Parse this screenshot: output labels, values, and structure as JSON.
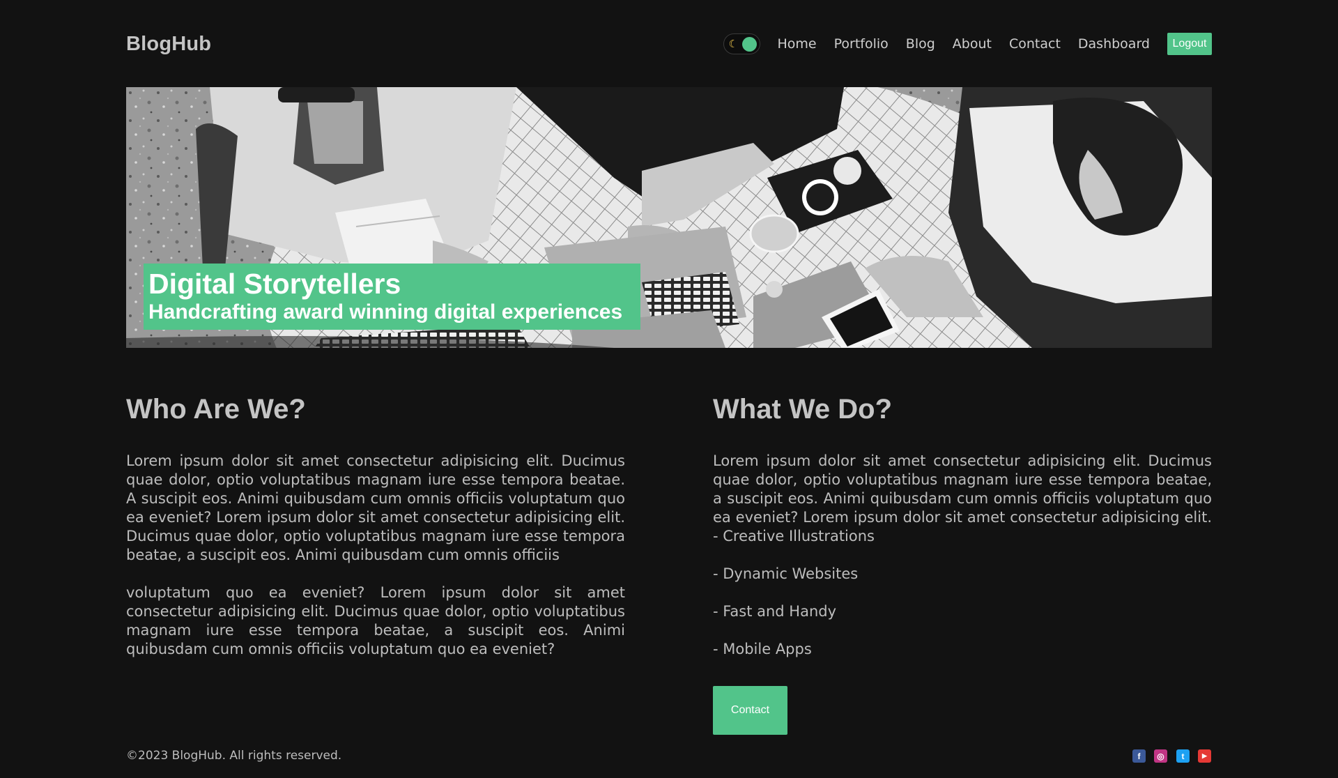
{
  "header": {
    "brand": "BlogHub",
    "theme_toggle": {
      "mode": "dark",
      "icon": "moon-icon"
    },
    "nav": [
      "Home",
      "Portfolio",
      "Blog",
      "About",
      "Contact",
      "Dashboard"
    ],
    "logout_label": "Logout"
  },
  "hero": {
    "image": "black-and-white-team-working-on-laptops-photo",
    "title": "Digital Storytellers",
    "subtitle": "Handcrafting award winning digital experiences"
  },
  "who": {
    "heading": "Who Are We?",
    "paragraphs": [
      "Lorem ipsum dolor sit amet consectetur adipisicing elit. Ducimus quae dolor, optio voluptatibus magnam iure esse tempora beatae. A suscipit eos. Animi quibusdam cum omnis officiis voluptatum quo ea eveniet? Lorem ipsum dolor sit amet consectetur adipisicing elit. Ducimus quae dolor, optio voluptatibus magnam iure esse tempora beatae, a suscipit eos. Animi quibusdam cum omnis officiis",
      "voluptatum quo ea eveniet? Lorem ipsum dolor sit amet consectetur adipisicing elit. Ducimus quae dolor, optio voluptatibus magnam iure esse tempora beatae, a suscipit eos. Animi quibusdam cum omnis officiis voluptatum quo ea eveniet?"
    ]
  },
  "what": {
    "heading": "What We Do?",
    "paragraph": "Lorem ipsum dolor sit amet consectetur adipisicing elit. Ducimus quae dolor, optio voluptatibus magnam iure esse tempora beatae, a suscipit eos. Animi quibusdam cum omnis officiis voluptatum quo ea eveniet? Lorem ipsum dolor sit amet consectetur adipisicing elit. - Creative Illustrations",
    "items": [
      "- Dynamic Websites",
      "- Fast and Handy",
      "- Mobile Apps"
    ],
    "contact_label": "Contact"
  },
  "footer": {
    "copyright": "©2023 BlogHub. All rights reserved.",
    "social": [
      {
        "name": "facebook-icon",
        "glyph": "f",
        "color": "#3b5998"
      },
      {
        "name": "instagram-icon",
        "glyph": "◎",
        "color": "#c13584"
      },
      {
        "name": "twitter-icon",
        "glyph": "t",
        "color": "#1da1f2"
      },
      {
        "name": "youtube-icon",
        "glyph": "▶",
        "color": "#e53935"
      }
    ]
  },
  "colors": {
    "background": "#121212",
    "accent": "#52c48a",
    "text": "#bdbdbd",
    "heading": "#c4c4c4"
  }
}
